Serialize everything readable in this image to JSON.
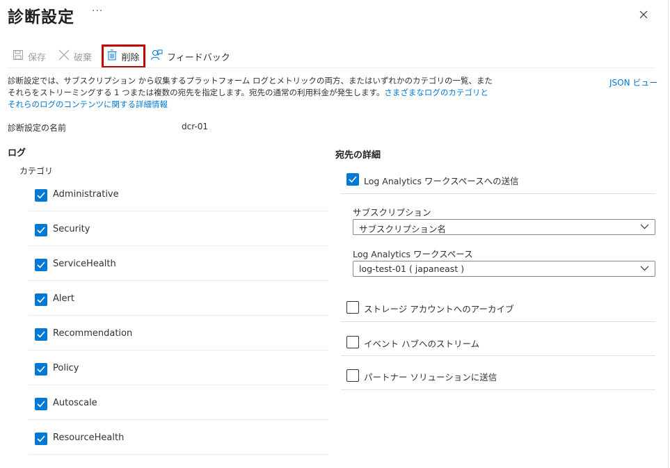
{
  "header": {
    "title": "診断設定",
    "more": "···"
  },
  "toolbar": {
    "save_label": "保存",
    "discard_label": "破棄",
    "delete_label": "削除",
    "feedback_label": "フィードバック"
  },
  "description": {
    "text": "診断設定では、サブスクリプション から収集するプラットフォーム ログとメトリックの両方、またはいずれかのカテゴリの一覧、またそれらをストリーミングする 1 つまたは複数の宛先を指定します。宛先の通常の利用料金が発生します。",
    "link": "さまざまなログのカテゴリとそれらのログのコンテンツに関する詳細情報",
    "json_view": "JSON ビュー"
  },
  "setting": {
    "name_label": "診断設定の名前",
    "name_value": "dcr-01"
  },
  "logs": {
    "heading": "ログ",
    "category_label": "カテゴリ",
    "categories": [
      {
        "label": "Administrative",
        "checked": true
      },
      {
        "label": "Security",
        "checked": true
      },
      {
        "label": "ServiceHealth",
        "checked": true
      },
      {
        "label": "Alert",
        "checked": true
      },
      {
        "label": "Recommendation",
        "checked": true
      },
      {
        "label": "Policy",
        "checked": true
      },
      {
        "label": "Autoscale",
        "checked": true
      },
      {
        "label": "ResourceHealth",
        "checked": true
      }
    ]
  },
  "destination": {
    "heading": "宛先の詳細",
    "log_analytics": {
      "label": "Log Analytics ワークスペースへの送信",
      "checked": true
    },
    "subscription": {
      "label": "サブスクリプション",
      "value": "サブスクリプション名"
    },
    "workspace": {
      "label": "Log Analytics ワークスペース",
      "value": "log-test-01 ( japaneast )"
    },
    "storage": {
      "label": "ストレージ アカウントへのアーカイブ",
      "checked": false
    },
    "event_hub": {
      "label": "イベント ハブへのストリーム",
      "checked": false
    },
    "partner": {
      "label": "パートナー ソリューションに送信",
      "checked": false
    }
  },
  "colors": {
    "accent": "#0078d4",
    "highlight": "#c00000",
    "border": "#edebe9"
  }
}
